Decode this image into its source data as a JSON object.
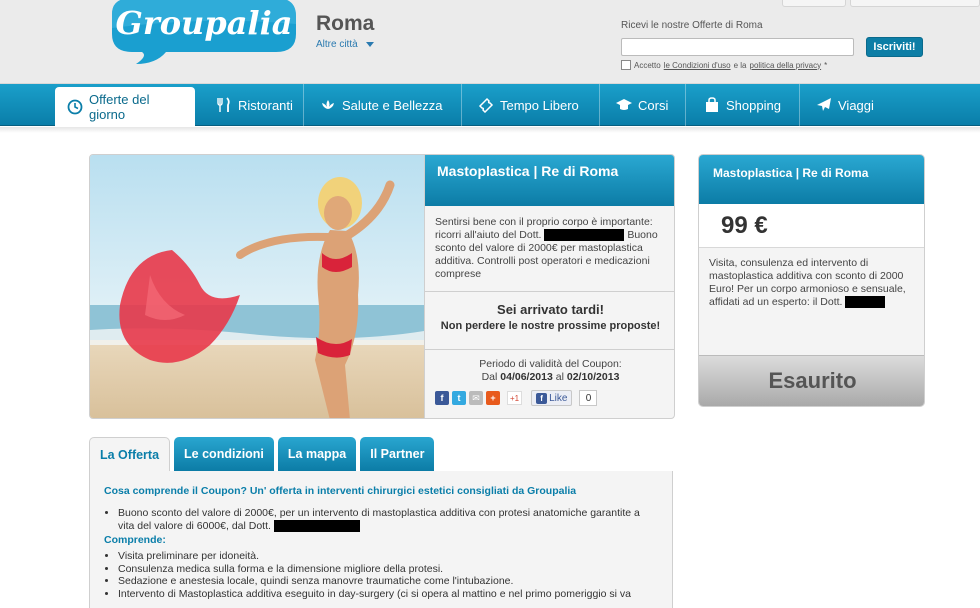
{
  "header": {
    "logo_text": "Groupalia",
    "city": "Roma",
    "other_cities": "Altre città",
    "newsletter_title": "Ricevi le nostre Offerte di Roma",
    "newsletter_placeholder": "",
    "subscribe_button": "Iscriviti!",
    "terms_prefix": "Accetto",
    "terms_link": "le Condizioni d'uso",
    "terms_middle": "e la",
    "privacy_link": "politica della privacy",
    "terms_suffix": "*"
  },
  "nav": {
    "items": [
      {
        "label": "Offerte del giorno",
        "icon": "clock-icon"
      },
      {
        "label": "Ristoranti",
        "icon": "cutlery-icon"
      },
      {
        "label": "Salute e Bellezza",
        "icon": "lotus-icon"
      },
      {
        "label": "Tempo Libero",
        "icon": "ticket-icon"
      },
      {
        "label": "Corsi",
        "icon": "graduation-cap-icon"
      },
      {
        "label": "Shopping",
        "icon": "shopping-bag-icon"
      },
      {
        "label": "Viaggi",
        "icon": "airplane-icon"
      }
    ]
  },
  "deal": {
    "title": "Mastoplastica | Re di Roma",
    "desc_1": "Sentirsi bene con il proprio corpo è importante: ricorri all'aiuto del Dott.",
    "desc_2": "Buono sconto del valore di 2000€ per mastoplastica additiva. Controlli post operatori e medicazioni comprese",
    "late_title": "Sei arrivato tardi!",
    "late_sub": "Non perdere le nostre prossime proposte!",
    "validity_label": "Periodo di validità del Coupon:",
    "validity_prefix": "Dal",
    "validity_from": "04/06/2013",
    "validity_middle": "al",
    "validity_to": "02/10/2013",
    "like_label": "Like",
    "like_count": "0",
    "gplus_label": "+1"
  },
  "side": {
    "title": "Mastoplastica | Re di Roma",
    "price": "99 €",
    "desc": "Visita, consulenza ed intervento di mastoplastica additiva con sconto di 2000 Euro! Per un corpo armonioso e sensuale, affidati ad un esperto: il Dott.",
    "status": "Esaurito"
  },
  "tabs": [
    "La Offerta",
    "Le condizioni",
    "La mappa",
    "Il Partner"
  ],
  "content": {
    "question": "Cosa comprende il Coupon? Un' offerta in interventi chirurgici estetici consigliati da Groupalia",
    "bullet_1": "Buono sconto del valore di 2000€, per un intervento di mastoplastica additiva con protesi anatomiche garantite a vita del valore di 6000€, dal Dott.",
    "comprende": "Comprende:",
    "items": [
      "Visita preliminare per idoneità.",
      "Consulenza medica sulla forma e la dimensione migliore della protesi.",
      "Sedazione e anestesia locale, quindi senza manovre traumatiche come l'intubazione.",
      "Intervento di Mastoplastica additiva eseguito in day-surgery (ci si opera al mattino e nel primo pomeriggio si va"
    ]
  },
  "colors": {
    "brand_blue": "#0c7ca6",
    "nav_blue": "#1a9fca"
  }
}
